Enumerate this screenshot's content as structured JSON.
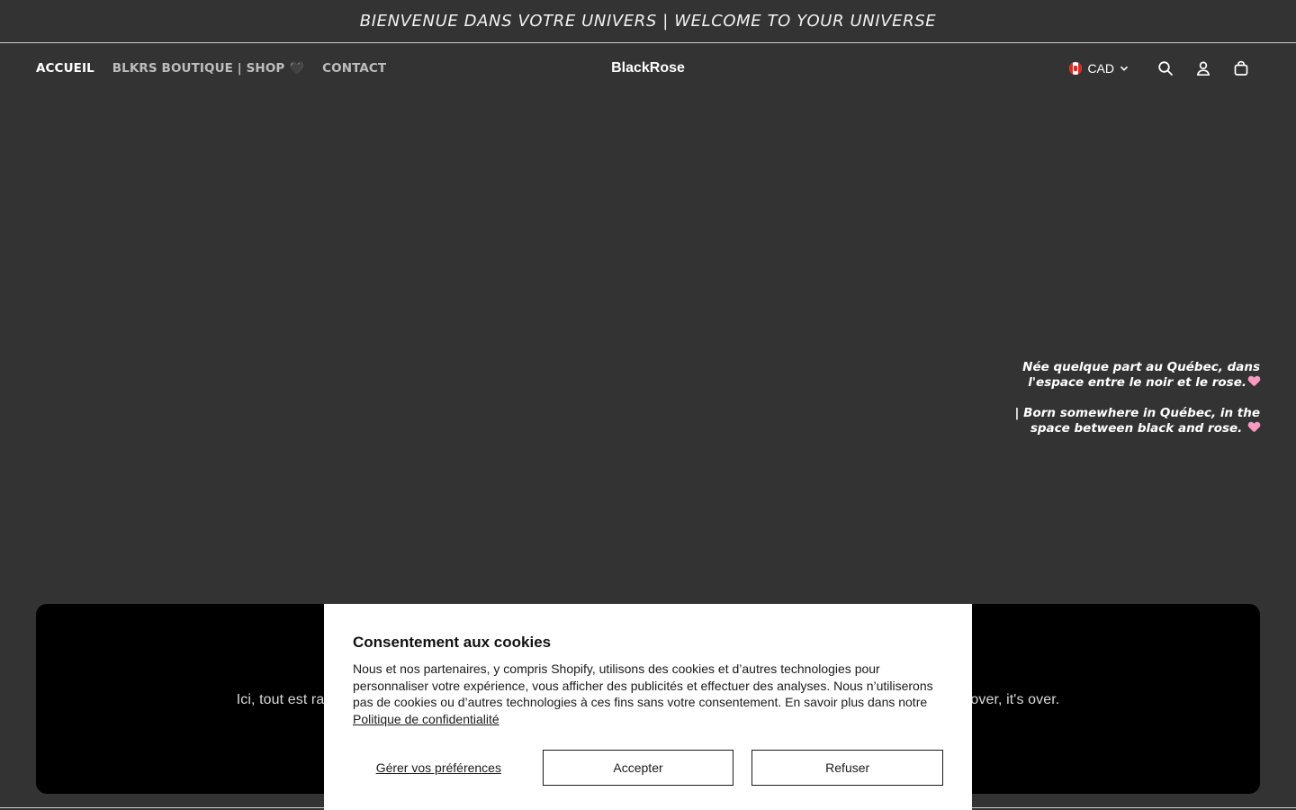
{
  "announcement": "BIENVENUE DANS VOTRE UNIVERS | WELCOME TO YOUR UNIVERSE",
  "header": {
    "nav": [
      "ACCUEIL",
      "BLKRS BOUTIQUE | SHOP 🖤",
      "CONTACT"
    ],
    "logo": "BlackRose",
    "currency": "CAD",
    "icons": [
      "search-icon",
      "account-icon",
      "cart-icon"
    ]
  },
  "hero": {
    "line_fr": "Née quelque part au Québec, dans l'espace entre le noir et le rose.",
    "line_en": "| Born somewhere in Québec, in the space between black and rose."
  },
  "banner": {
    "text_left": "Ici, tout est ra",
    "text_right": "over, it's over."
  },
  "cookie": {
    "title": "Consentement aux cookies",
    "body": "Nous et nos partenaires, y compris Shopify, utilisons des cookies et d’autres technologies pour personnaliser votre expérience, vous afficher des publicités et effectuer des analyses. Nous n’utiliserons pas de cookies ou d’autres technologies à ces fins sans votre consentement. En savoir plus dans notre",
    "link": "Politique de confidentialité",
    "manage": "Gérer vos préférences",
    "accept": "Accepter",
    "decline": "Refuser"
  },
  "colors": {
    "background": "#333333",
    "banner": "#000000",
    "heart": "#f79ac0"
  }
}
